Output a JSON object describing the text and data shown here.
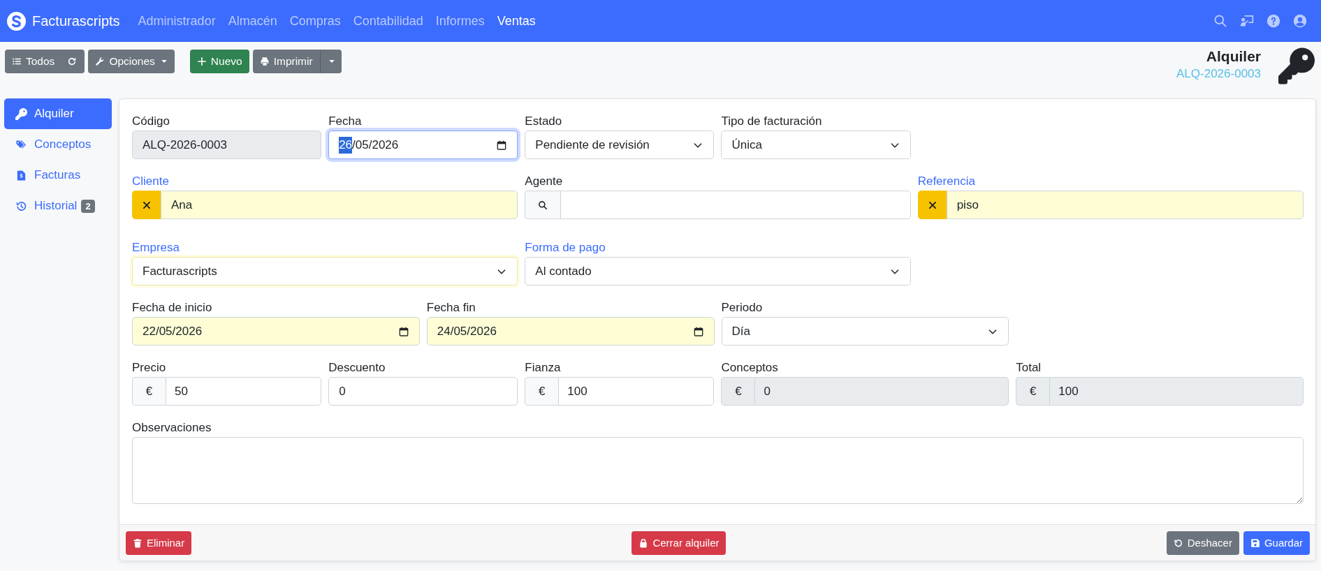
{
  "navbar": {
    "brand": "Facturascripts",
    "menu": [
      {
        "label": "Administrador",
        "selected": false
      },
      {
        "label": "Almacén",
        "selected": false
      },
      {
        "label": "Compras",
        "selected": false
      },
      {
        "label": "Contabilidad",
        "selected": false
      },
      {
        "label": "Informes",
        "selected": false
      },
      {
        "label": "Ventas",
        "selected": true
      }
    ]
  },
  "toolbar": {
    "all_button": "Todos",
    "options_button": "Opciones",
    "new_button": "Nuevo",
    "print_button": "Imprimir"
  },
  "header": {
    "title": "Alquiler",
    "code": "ALQ-2026-0003"
  },
  "sidebar": {
    "items": [
      {
        "label": "Alquiler",
        "selected": true
      },
      {
        "label": "Conceptos",
        "selected": false
      },
      {
        "label": "Facturas",
        "selected": false
      },
      {
        "label": "Historial",
        "selected": false,
        "badge": "2"
      }
    ]
  },
  "form": {
    "rows": [
      {
        "fields": [
          {
            "label": "Código",
            "kind": "text",
            "value": "ALQ-2026-0003",
            "link": false,
            "required": false,
            "readonly": true,
            "focused": false
          },
          {
            "label": "Fecha",
            "kind": "date",
            "value": "26/05/2026",
            "link": false,
            "required": false,
            "readonly": false,
            "focused": true
          },
          {
            "label": "Estado",
            "kind": "select",
            "value": "Pendiente de revisión",
            "link": false,
            "required": false,
            "readonly": false,
            "focused": false
          },
          {
            "label": "Tipo de facturación",
            "kind": "select",
            "value": "Única",
            "link": false,
            "required": false,
            "readonly": false,
            "focused": false
          }
        ]
      },
      {
        "fields": [
          {
            "label": "Cliente",
            "kind": "autocomplete",
            "value": "Ana",
            "link": true,
            "required": true,
            "readonly": false,
            "focused": false
          },
          {
            "label": "Agente",
            "kind": "search",
            "link": false,
            "required": false,
            "readonly": false,
            "focused": false
          },
          {
            "label": "Referencia",
            "kind": "autocomplete",
            "value": "piso",
            "link": true,
            "required": true,
            "readonly": false,
            "focused": false
          }
        ]
      },
      {
        "fields": [
          {
            "label": "Empresa",
            "kind": "select",
            "value": "Facturascripts",
            "link": true,
            "required": true,
            "readonly": false,
            "focused": false
          },
          {
            "label": "Forma de pago",
            "kind": "select",
            "value": "Al contado",
            "link": true,
            "required": false,
            "readonly": false,
            "focused": false
          }
        ]
      },
      {
        "fields": [
          {
            "label": "Fecha de inicio",
            "kind": "date",
            "value": "22/05/2026",
            "link": false,
            "required": true,
            "readonly": false,
            "focused": false
          },
          {
            "label": "Fecha fin",
            "kind": "date",
            "value": "24/05/2026",
            "link": false,
            "required": true,
            "readonly": false,
            "focused": false
          },
          {
            "label": "Periodo",
            "kind": "select",
            "value": "Día",
            "link": false,
            "required": false,
            "readonly": false,
            "focused": false
          }
        ]
      },
      {
        "fields": [
          {
            "label": "Precio",
            "kind": "currency",
            "prefix": "€",
            "value": "50",
            "link": false,
            "required": false,
            "readonly": false,
            "focused": false
          },
          {
            "label": "Descuento",
            "kind": "number",
            "value": "0",
            "link": false,
            "required": false,
            "readonly": false,
            "focused": false
          },
          {
            "label": "Fianza",
            "kind": "currency",
            "prefix": "€",
            "value": "100",
            "link": false,
            "required": false,
            "readonly": false,
            "focused": false
          },
          {
            "label": "Conceptos",
            "kind": "currency",
            "prefix": "€",
            "value": "0",
            "link": false,
            "required": false,
            "readonly": true,
            "focused": false
          },
          {
            "label": "Total",
            "kind": "currency",
            "prefix": "€",
            "value": "100",
            "link": false,
            "required": false,
            "readonly": true,
            "focused": false
          }
        ]
      },
      {
        "fields": [
          {
            "label": "Observaciones",
            "kind": "textarea",
            "link": false,
            "required": false,
            "readonly": false,
            "focused": false
          }
        ]
      }
    ]
  },
  "footer": {
    "delete_button": "Eliminar",
    "close_button": "Cerrar alquiler",
    "undo_button": "Deshacer",
    "save_button": "Guardar"
  }
}
